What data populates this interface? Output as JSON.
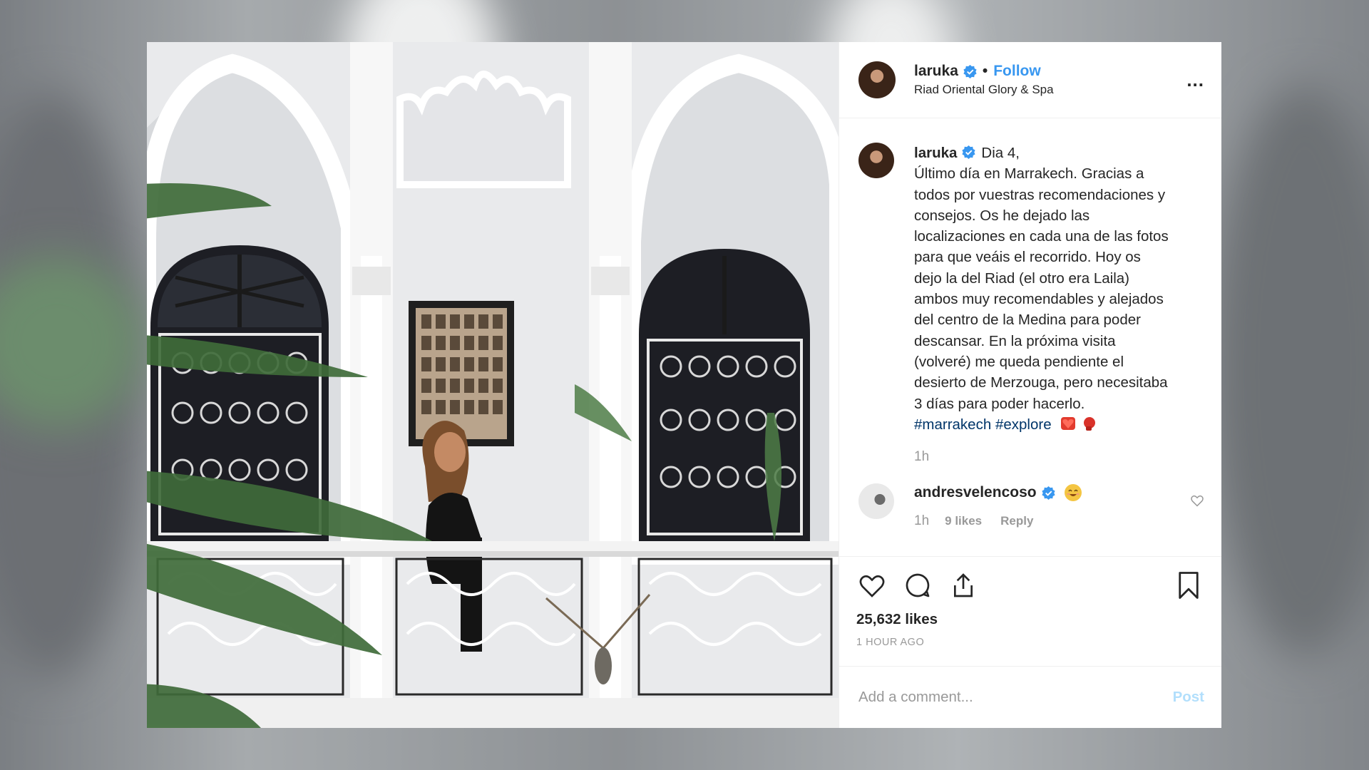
{
  "post": {
    "username": "laruka",
    "follow_label": "Follow",
    "separator": "•",
    "location": "Riad Oriental Glory & Spa",
    "more_label": "...",
    "caption": {
      "username": "laruka",
      "text_lines": [
        "Dia 4,",
        "Último día en Marrakech. Gracias a",
        "todos por vuestras recomendaciones y",
        "consejos. Os he dejado las",
        "localizaciones en cada una de las fotos",
        "para que veáis el recorrido. Hoy os",
        "dejo la del Riad (el otro era Laila)",
        "ambos muy recomendables y alejados",
        "del centro de la Medina para poder",
        "descansar. En la próxima visita",
        "(volveré) me queda pendiente el",
        "desierto de Merzouga, pero necesitaba",
        "3 días para poder hacerlo."
      ],
      "hashtag_1": "#marrakech",
      "hashtag_2": "#explore",
      "emojis": [
        "red-heart-emoji",
        "boxing-glove-emoji"
      ],
      "timestamp": "1h"
    },
    "comment": {
      "username": "andresvelencoso",
      "emoji": "smiling-face-emoji",
      "time": "1h",
      "likes": "9 likes",
      "reply_label": "Reply"
    },
    "likes_count": "25,632 likes",
    "time_ago": "1 HOUR AGO",
    "add_comment_placeholder": "Add a comment...",
    "post_button_label": "Post"
  },
  "colors": {
    "link_blue": "#3897f0",
    "hashtag_blue": "#003569",
    "muted_gray": "#999999",
    "post_button_disabled": "#b2dffc",
    "verified_blue": "#3897f0"
  },
  "icons": {
    "like": "heart-icon",
    "comment": "comment-icon",
    "share": "share-icon",
    "save": "bookmark-icon",
    "verified": "verified-badge-icon",
    "more": "more-options-icon"
  }
}
